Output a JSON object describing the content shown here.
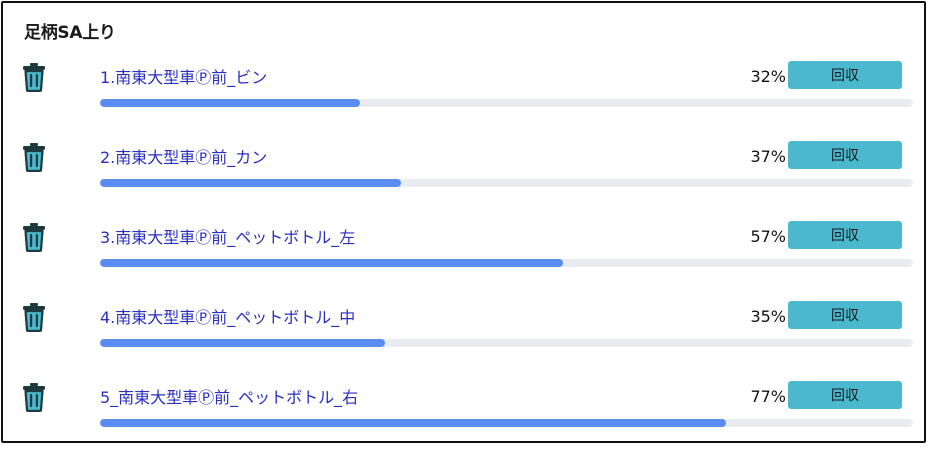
{
  "header": {
    "title": "足柄SA上り"
  },
  "items": [
    {
      "label": "1.南東大型車Ⓟ前_ビン",
      "percent_text": "32%",
      "progress": 0.32,
      "button_label": "回収"
    },
    {
      "label": "2.南東大型車Ⓟ前_カン",
      "percent_text": "37%",
      "progress": 0.37,
      "button_label": "回収"
    },
    {
      "label": "3.南東大型車Ⓟ前_ペットボトル_左",
      "percent_text": "57%",
      "progress": 0.57,
      "button_label": "回収"
    },
    {
      "label": "4.南東大型車Ⓟ前_ペットボトル_中",
      "percent_text": "35%",
      "progress": 0.35,
      "button_label": "回収"
    },
    {
      "label": "5_南東大型車Ⓟ前_ペットボトル_右",
      "percent_text": "77%",
      "progress": 0.77,
      "button_label": "回収"
    }
  ],
  "icons": {
    "delete": "trash-icon"
  },
  "colors": {
    "link": "#2a2fc0",
    "button": "#4bb8cd",
    "progress_fill": "#5b8cf0",
    "progress_track": "#ebebf2",
    "trash_outline": "#1d3b3f",
    "trash_fill": "#4bb8cd"
  }
}
